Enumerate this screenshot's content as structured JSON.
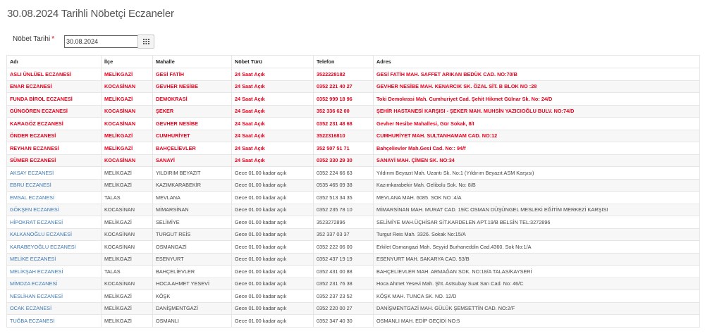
{
  "page": {
    "title": "30.08.2024 Tarihli Nöbetçi Eczaneler"
  },
  "filter": {
    "label": "Nöbet Tarihi",
    "required_mark": "*",
    "date_value": "30.08.2024",
    "button_icon": "calendar-icon"
  },
  "colors": {
    "highlight_text": "#e8001c",
    "link_text": "#3c78b4",
    "border": "#e6e6e6"
  },
  "table": {
    "headers": [
      "Adı",
      "İlçe",
      "Mahalle",
      "Nöbet Türü",
      "Telefon",
      "Adres"
    ],
    "rows": [
      {
        "highlight": true,
        "name": "ASLI ÜNLÜEL ECZANESİ",
        "district": "MELİKGAZİ",
        "neighborhood": "GESİ FATİH",
        "duty": "24 Saat Açık",
        "phone": "3522228182",
        "address": "GESİ FATİH MAH. SAFFET ARIKAN BEDÜK CAD. NO:70/B"
      },
      {
        "highlight": true,
        "name": "ENAR ECZANESİ",
        "district": "KOCASİNAN",
        "neighborhood": "GEVHER NESİBE",
        "duty": "24 Saat Açık",
        "phone": "0352 221 40 27",
        "address": "GEVHER NESİBE MAH. KENARCIK SK. ÖZAL SİT. B BLOK NO :28"
      },
      {
        "highlight": true,
        "name": "FUNDA BİROL ECZANESİ",
        "district": "MELİKGAZİ",
        "neighborhood": "DEMOKRASİ",
        "duty": "24 Saat Açık",
        "phone": "0352 999 18 96",
        "address": "Toki Demokrasi Mah. Cumhuriyet Cad. Şehit Hikmet Gülnar Sk. No: 24/D"
      },
      {
        "highlight": true,
        "name": "GÜNGÖREN ECZANESİ",
        "district": "KOCASİNAN",
        "neighborhood": "ŞEKER",
        "duty": "24 Saat Açık",
        "phone": "352 336 62 00",
        "address": "ŞEHİR HASTANESİ KARŞISI - ŞEKER MAH. MUHSİN YAZICIOĞLU BULV. NO:74/D"
      },
      {
        "highlight": true,
        "name": "KARAGÖZ ECZANESİ",
        "district": "KOCASİNAN",
        "neighborhood": "GEVHER NESİBE",
        "duty": "24 Saat Açık",
        "phone": "0352 231 48 68",
        "address": "Gevher Nesibe Mahallesi, Gür Sokak, 8/I"
      },
      {
        "highlight": true,
        "name": "ÖNDER ECZANESİ",
        "district": "MELİKGAZİ",
        "neighborhood": "CUMHURİYET",
        "duty": "24 Saat Açık",
        "phone": "3522316810",
        "address": "CUMHURİYET MAH. SULTANHAMAM CAD. NO:12"
      },
      {
        "highlight": true,
        "name": "REYHAN ECZANESİ",
        "district": "MELİKGAZİ",
        "neighborhood": "BAHÇELİEVLER",
        "duty": "24 Saat Açık",
        "phone": "352 507 51 71",
        "address": "Bahçelievler Mah.Gesi Cad. No:: 94/f"
      },
      {
        "highlight": true,
        "name": "SÜMER ECZANESİ",
        "district": "KOCASİNAN",
        "neighborhood": "SANAYİ",
        "duty": "24 Saat Açık",
        "phone": "0352 330 29 30",
        "address": "SANAYİ MAH. ÇİMEN SK. NO:34"
      },
      {
        "highlight": false,
        "name": "AKSAY ECZANESİ",
        "district": "MELİKGAZİ",
        "neighborhood": "YILDIRIM BEYAZIT",
        "duty": "Gece 01.00 kadar açık",
        "phone": "0352 224 66 63",
        "address": "Yıldırım Beyazıt Mah. Uzantı Sk. No:1 (Yıldırım Beyazıt ASM Karşısı)"
      },
      {
        "highlight": false,
        "name": "EBRU ECZANESİ",
        "district": "MELİKGAZİ",
        "neighborhood": "KAZIMKARABEKİR",
        "duty": "Gece 01.00 kadar açık",
        "phone": "0535 465 09 38",
        "address": "Kazımkarabekir Mah. Gelibolu Sok. No: 8/B"
      },
      {
        "highlight": false,
        "name": "EMSAL ECZANESİ",
        "district": "TALAS",
        "neighborhood": "MEVLANA",
        "duty": "Gece 01.00 kadar açık",
        "phone": "0352 513 34 35",
        "address": "MEVLANA MAH. 6085. SOK NO :4/A"
      },
      {
        "highlight": false,
        "name": "GÖKŞEN ECZANESİ",
        "district": "KOCASİNAN",
        "neighborhood": "MİMARSİNAN",
        "duty": "Gece 01.00 kadar açık",
        "phone": "0352 235 78 10",
        "address": "MİMARSİNAN MAH. MURAT CAD. 19/C OSMAN DÜŞÜNGEL MESLEKİ EĞİTİM MERKEZİ KARŞISI"
      },
      {
        "highlight": false,
        "name": "HİPOKRAT ECZANESİ",
        "district": "MELİKGAZİ",
        "neighborhood": "SELİMİYE",
        "duty": "Gece 01.00 kadar açık",
        "phone": "3523272896",
        "address": "SELİMİYE MAH.ÜÇHİSAR SİT.KARDELEN APT.19/B BELSİN TEL:3272896"
      },
      {
        "highlight": false,
        "name": "KALKANOĞLU ECZANESİ",
        "district": "KOCASİNAN",
        "neighborhood": "TURGUT REİS",
        "duty": "Gece 01.00 kadar açık",
        "phone": "352 337 03 37",
        "address": "Turgut Reis Mah. 3326. Sokak No:15/A"
      },
      {
        "highlight": false,
        "name": "KARABEYOĞLU ECZANESİ",
        "district": "KOCASİNAN",
        "neighborhood": "OSMANGAZİ",
        "duty": "Gece 01.00 kadar açık",
        "phone": "0352 222 06 00",
        "address": "Erkilet Osmangazi Mah. Seyyid Burhaneddin Cad.4360. Sok No:1/A"
      },
      {
        "highlight": false,
        "name": "MELİKE ECZANESİ",
        "district": "MELİKGAZİ",
        "neighborhood": "ESENYURT",
        "duty": "Gece 01.00 kadar açık",
        "phone": "0352 437 19 19",
        "address": "ESENYURT MAH. SAKARYA CAD. 53/B"
      },
      {
        "highlight": false,
        "name": "MELİKŞAH ECZANESİ",
        "district": "TALAS",
        "neighborhood": "BAHÇELİEVLER",
        "duty": "Gece 01.00 kadar açık",
        "phone": "0352 431 00 88",
        "address": "BAHÇELİEVLER MAH. ARMAĞAN SOK. NO:18/A TALAS/KAYSERİ"
      },
      {
        "highlight": false,
        "name": "MİMOZA ECZANESİ",
        "district": "KOCASİNAN",
        "neighborhood": "HOCA AHMET YESEVİ",
        "duty": "Gece 01.00 kadar açık",
        "phone": "0352 231 76 38",
        "address": "Hoca Ahmet Yesevi Mah. Şht. Astsubay Suat Sarı Cad. No: 46/C"
      },
      {
        "highlight": false,
        "name": "NESLİHAN ECZANESİ",
        "district": "MELİKGAZİ",
        "neighborhood": "KÖŞK",
        "duty": "Gece 01.00 kadar açık",
        "phone": "0352 237 23 52",
        "address": "KÖŞK MAH. TUNCA SK. NO. 12/D"
      },
      {
        "highlight": false,
        "name": "OCAK ECZANESİ",
        "district": "MELİKGAZİ",
        "neighborhood": "DANİŞMENTGAZİ",
        "duty": "Gece 01.00 kadar açık",
        "phone": "0352 220 00 27",
        "address": "DANİŞMENTGAZİ MAH. GÜLÜK ŞEMSETTİN CAD. NO:2/F"
      },
      {
        "highlight": false,
        "name": "TUĞBA ECZANESİ",
        "district": "MELİKGAZİ",
        "neighborhood": "OSMANLI",
        "duty": "Gece 01.00 kadar açık",
        "phone": "0352 347 40 30",
        "address": "OSMANLI MAH. EDİP GEÇİDİ NO:5"
      }
    ]
  }
}
